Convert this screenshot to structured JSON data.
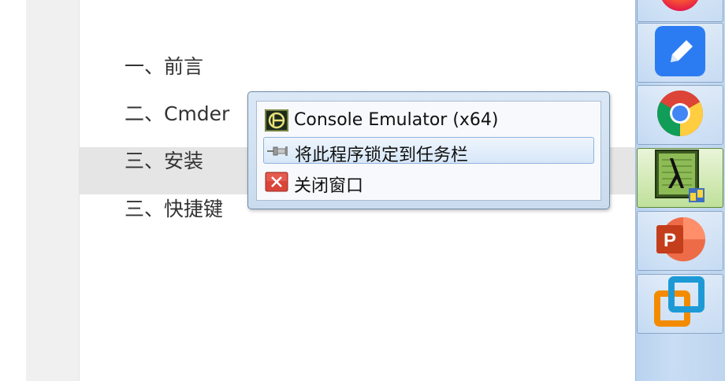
{
  "document": {
    "toc": [
      {
        "label": "一、前言"
      },
      {
        "label": "二、Cmder"
      },
      {
        "label": "三、安装"
      },
      {
        "label": "三、快捷键"
      }
    ]
  },
  "jumplist": {
    "app_title": "Console Emulator (x64)",
    "pin_label": "将此程序锁定到任务栏",
    "close_label": "关闭窗口",
    "icons": {
      "app": "console-emulator-icon",
      "pin": "pin-icon",
      "close": "close-window-icon"
    }
  },
  "taskbar": {
    "buttons": [
      {
        "name": "firefox-icon"
      },
      {
        "name": "notes-pencil-icon"
      },
      {
        "name": "chrome-icon"
      },
      {
        "name": "cmder-lambda-icon",
        "state": "hot"
      },
      {
        "name": "powerpoint-icon"
      },
      {
        "name": "vmware-icon"
      }
    ]
  },
  "colors": {
    "taskbar": "#c9ddf4",
    "highlight": "#e5e5e5",
    "accent_green": "#5b8a3a"
  }
}
